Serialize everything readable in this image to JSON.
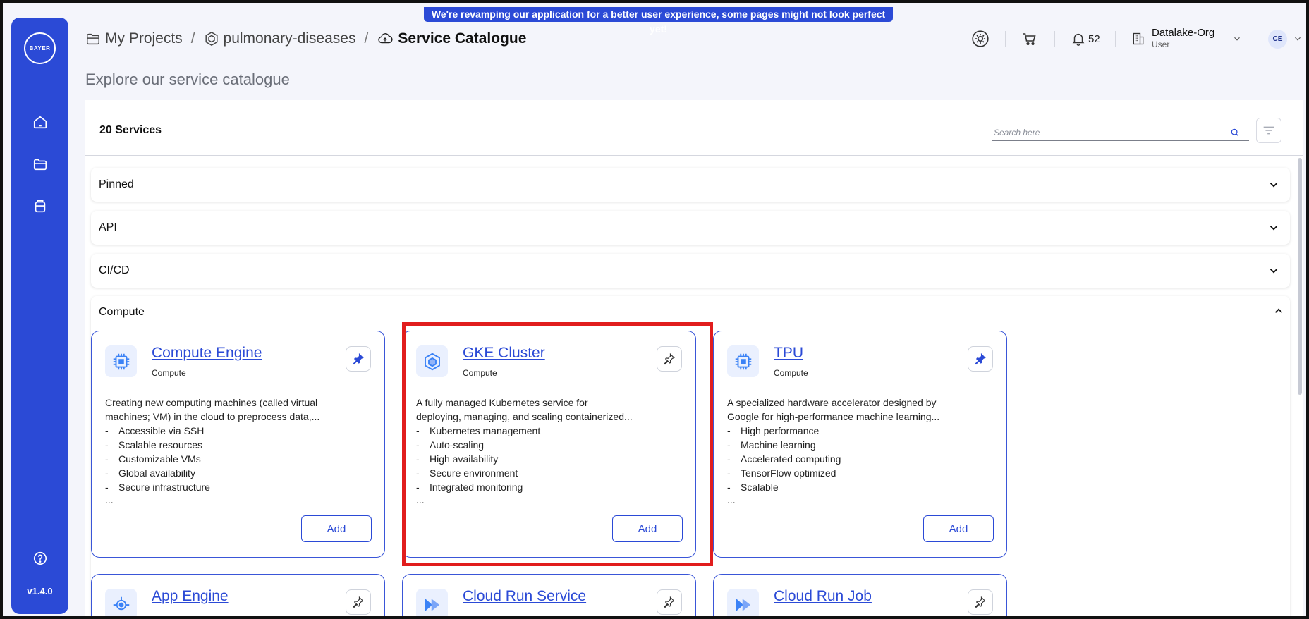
{
  "banner": "We're revamping our application for a better user experience, some pages might not look perfect yet!",
  "sidebar": {
    "logo_text": "BAYER",
    "version": "v1.4.0"
  },
  "breadcrumb": {
    "root": "My Projects",
    "project": "pulmonary-diseases",
    "current": "Service Catalogue"
  },
  "header": {
    "notification_count": "52",
    "org_name": "Datalake-Org",
    "org_role": "User",
    "avatar_initials": "CE"
  },
  "page_subtitle": "Explore our service catalogue",
  "catalog": {
    "count_label": "20 Services",
    "search_placeholder": "Search here",
    "sections": {
      "pinned": "Pinned",
      "api": "API",
      "cicd": "CI/CD",
      "compute": "Compute"
    },
    "more": "...",
    "cards": [
      {
        "title": "Compute Engine",
        "category": "Compute",
        "desc1": "Creating new computing machines (called virtual",
        "desc2": "machines; VM) in the cloud to preprocess data,...",
        "features": [
          "Accessible via SSH",
          "Scalable resources",
          "Customizable VMs",
          "Global availability",
          "Secure infrastructure"
        ],
        "button": "Add",
        "pinned": true
      },
      {
        "title": "GKE Cluster",
        "category": "Compute",
        "desc1": "A fully managed Kubernetes service for",
        "desc2": "deploying, managing, and scaling containerized...",
        "features": [
          "Kubernetes management",
          "Auto-scaling",
          "High availability",
          "Secure environment",
          "Integrated monitoring"
        ],
        "button": "Add",
        "pinned": false
      },
      {
        "title": "TPU",
        "category": "Compute",
        "desc1": "A specialized hardware accelerator designed by",
        "desc2": "Google for high-performance machine learning...",
        "features": [
          "High performance",
          "Machine learning",
          "Accelerated computing",
          "TensorFlow optimized",
          "Scalable"
        ],
        "button": "Add",
        "pinned": true
      },
      {
        "title": "App Engine",
        "pinned": false
      },
      {
        "title": "Cloud Run Service",
        "pinned": false
      },
      {
        "title": "Cloud Run Job",
        "pinned": false
      }
    ]
  },
  "colors": {
    "brand": "#2b4ad6",
    "highlight": "#e11d1d",
    "background": "#f4f5fb"
  }
}
